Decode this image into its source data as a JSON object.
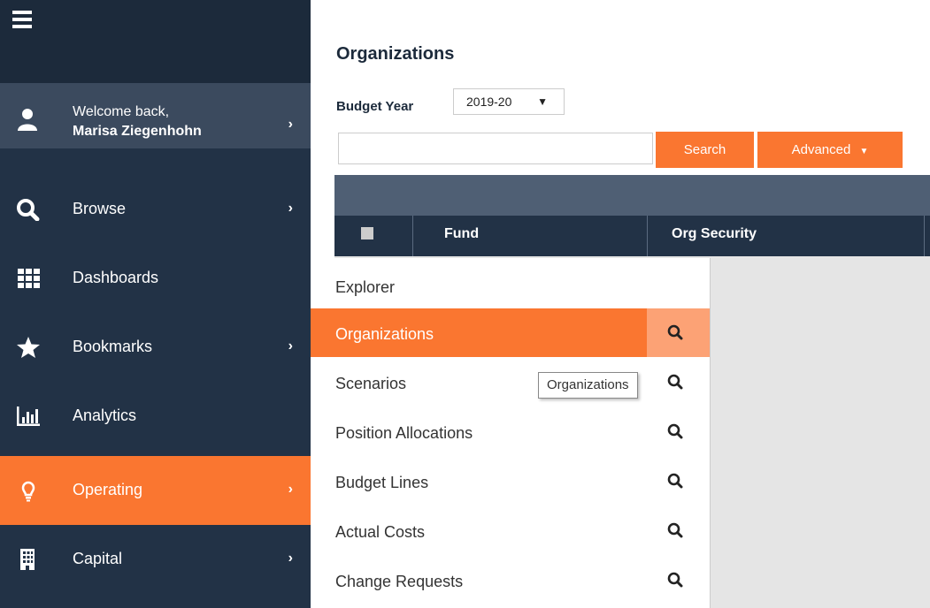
{
  "sidebar": {
    "welcome_line": "Welcome back,",
    "user_name": "Marisa Ziegenhohn",
    "items": [
      {
        "label": "Browse",
        "icon": "search-icon",
        "has_chevron": true
      },
      {
        "label": "Dashboards",
        "icon": "grid-icon",
        "has_chevron": false
      },
      {
        "label": "Bookmarks",
        "icon": "star-icon",
        "has_chevron": true
      },
      {
        "label": "Analytics",
        "icon": "bar-chart-icon",
        "has_chevron": false
      },
      {
        "label": "Operating",
        "icon": "lightbulb-icon",
        "has_chevron": true,
        "active": true
      },
      {
        "label": "Capital",
        "icon": "building-icon",
        "has_chevron": true
      }
    ]
  },
  "main": {
    "title": "Organizations",
    "budget_year_label": "Budget Year",
    "budget_year_value": "2019-20",
    "search_value": "",
    "search_button": "Search",
    "advanced_button": "Advanced",
    "columns": [
      "Fund",
      "Org Security"
    ]
  },
  "menu": {
    "items": [
      {
        "label": "Explorer",
        "has_search": false
      },
      {
        "label": "Organizations",
        "has_search": true,
        "active": true
      },
      {
        "label": "Scenarios",
        "has_search": true
      },
      {
        "label": "Position Allocations",
        "has_search": true
      },
      {
        "label": "Budget Lines",
        "has_search": true
      },
      {
        "label": "Actual Costs",
        "has_search": true
      },
      {
        "label": "Change Requests",
        "has_search": true
      }
    ]
  },
  "tooltip": "Organizations",
  "colors": {
    "sidebar_bg": "#223246",
    "accent": "#fa7630",
    "grid_header": "#4f5f74"
  }
}
